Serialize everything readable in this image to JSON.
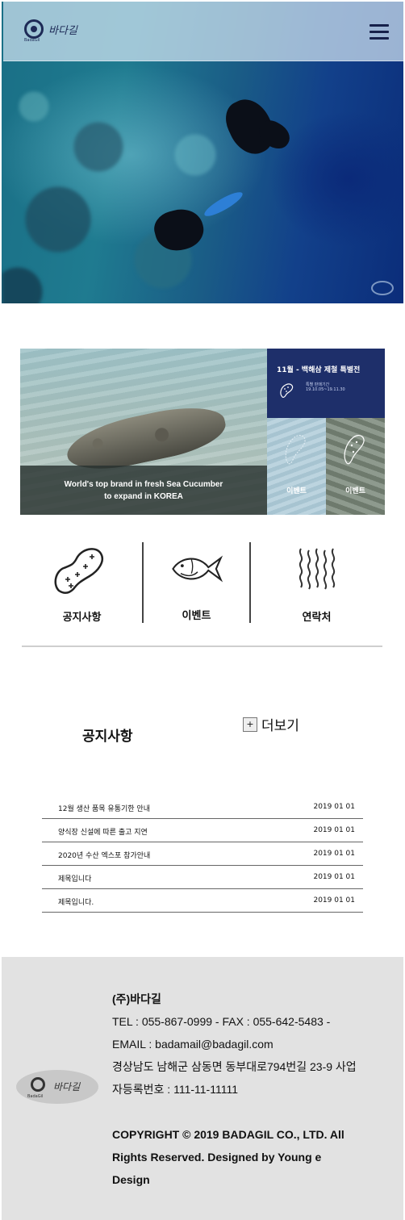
{
  "header": {
    "logo_text": "바다길",
    "logo_sub": "BadaGil"
  },
  "promo": {
    "caption_line1": "World's top brand in fresh Sea Cucumber",
    "caption_line2": "to expand in KOREA",
    "event_title": "11월 - 백해삼 제철 특별전",
    "event_period_label": "특별 판매기간",
    "event_period": "19.10.05~19.11.30",
    "tile_a_label": "이벤트",
    "tile_b_label": "이벤트"
  },
  "quick_links": [
    {
      "label": "공지사항",
      "icon": "sea-cucumber-icon"
    },
    {
      "label": "이벤트",
      "icon": "fish-icon"
    },
    {
      "label": "연락처",
      "icon": "waves-icon"
    }
  ],
  "notice": {
    "title": "공지사항",
    "more_plus": "+",
    "more_label": "더보기",
    "items": [
      {
        "title": "12월 생산 품목 유통기한 안내",
        "date": "2019 01 01"
      },
      {
        "title": "양식장 신설에 따른 출고 지연",
        "date": "2019 01 01"
      },
      {
        "title": "2020년 수산 엑스포 참가안내",
        "date": "2019 01 01"
      },
      {
        "title": "제목입니다",
        "date": "2019 01 01"
      },
      {
        "title": "제목입니다.",
        "date": "2019 01 01"
      }
    ]
  },
  "footer": {
    "logo_text": "바다길",
    "logo_sub": "BadaGil",
    "company": "(주)바다길",
    "tel_fax": "TEL : 055-867-0999 - FAX : 055-642-5483 -",
    "email": "EMAIL : badamail@badagil.com",
    "address": "경상남도 남해군 삼동면 동부대로794번길 23-9 사업",
    "business_no": "자등록번호 : 111-11-11111",
    "copyright_1": "COPYRIGHT © 2019 BADAGIL CO., LTD. All",
    "copyright_2": "Rights Reserved. Designed by Young e",
    "copyright_3": "Design"
  },
  "colors": {
    "navy": "#1e2f6a",
    "footer_bg": "#e2e2e2",
    "header_overlay": "#d2e4f2"
  }
}
